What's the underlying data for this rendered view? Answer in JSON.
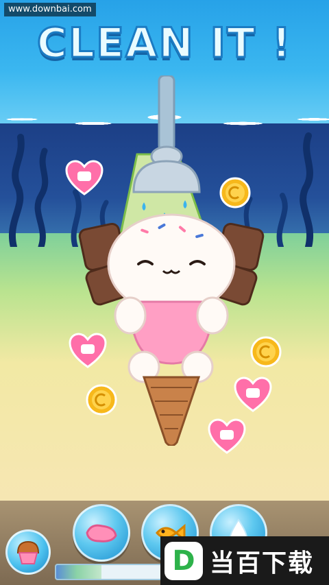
{
  "watermark": {
    "text": "www.downbai.com"
  },
  "title": {
    "text": "CLEAN IT !"
  },
  "progress": {
    "fraction": 0.42
  },
  "tools": [
    {
      "name": "sponge",
      "icon": "sponge-icon"
    },
    {
      "name": "fish",
      "icon": "fish-icon"
    },
    {
      "name": "water",
      "icon": "water-drop-icon"
    }
  ],
  "cupcake": {
    "icon": "cupcake-icon"
  },
  "brand": {
    "badge": "D",
    "text": "当百下载"
  },
  "colors": {
    "sky": "#27a2e8",
    "deep_sea": "#1c3f86",
    "heart": "#ff6fa9",
    "coin": "#f7b81b",
    "title_fill": "#e9fbff",
    "title_stroke": "#1b7bc3"
  }
}
